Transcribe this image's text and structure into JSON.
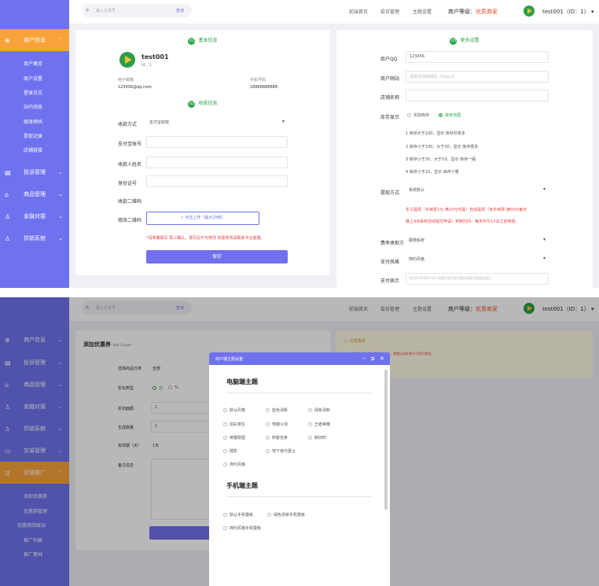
{
  "top": {
    "search_placeholder": "输入订单号",
    "search_btn": "查询",
    "nav": [
      "前端首页",
      "投诉管理",
      "主题设置"
    ],
    "level_label": "商户等级：",
    "level_value": "优质商家",
    "user": "test001（ID：1）",
    "user_caret": "▾"
  },
  "s1": {
    "sidebar": {
      "main": [
        {
          "label": "商户信息",
          "icon": "⊕"
        },
        {
          "label": "投诉管理",
          "icon": "▤"
        },
        {
          "label": "商品管理",
          "icon": "⌂"
        },
        {
          "label": "金融对接",
          "icon": "♙"
        },
        {
          "label": "供销系统",
          "icon": "♙"
        }
      ],
      "sub": [
        "商户概览",
        "商户设置",
        "登录日志",
        "站内消息",
        "修改密码",
        "提现记录",
        "店铺链接"
      ]
    },
    "basic": {
      "num": "01",
      "title": "基本信息",
      "name": "test001",
      "sub": "id：1",
      "email_label": "电子邮箱",
      "email": "123456@qq.com",
      "phone_label": "手机号码",
      "phone": "18888888888"
    },
    "receipt": {
      "num": "02",
      "title": "收款信息",
      "method_label": "收款方式",
      "method": "支付宝收款",
      "account_label": "支付宝账号",
      "name_label": "收款人姓名",
      "id_label": "身份证号",
      "qr_label": "收款二维码",
      "modify_label": "修改二维码",
      "upload": "点击上传（最大2MB）",
      "warn": "*请准确填写 再三确认，填写后不可修改 如需修改请联系平台客服。",
      "save": "保存"
    },
    "more": {
      "num": "03",
      "title": "更多设置",
      "qq_label": "商户QQ",
      "qq": "123456",
      "site_label": "商户网站",
      "site_ph": "请填写你的网站（http://）",
      "shop_label": "店铺名称",
      "stock_label": "库存显示",
      "stock_opts": [
        "实际库存",
        "库存范围"
      ],
      "stock_rules": [
        "1  库存大于100，显示 库存非常多",
        "2  库存小于100、大于30，显示 库存很多",
        "3  库存小于30、大于10，显示 库存一般",
        "4  库存小于10，显示 库存少量"
      ],
      "withdraw_label": "提现方式",
      "withdraw": "系统默认",
      "withdraw_note1": "手工提现（手续费2元 满10元可提）自动提现（免手续费 满50元每天",
      "withdraw_note2": "晚上9点系统自动提交申请）到账时间：每天中午12点之前到账。",
      "fee_label": "费率承担方",
      "fee": "跟随系统",
      "pay_label": "支付风格",
      "pay": "简约风格",
      "pay_ext_label": "支付表示",
      "pay_ext": "例如0-459597311 再遇订单出现问题前请联系客服或售后"
    }
  },
  "s2": {
    "sidebar": {
      "main": [
        {
          "label": "商户信息",
          "icon": "⊕"
        },
        {
          "label": "投诉管理",
          "icon": "▤"
        },
        {
          "label": "商品管理",
          "icon": "⌂"
        },
        {
          "label": "金融对接",
          "icon": "♙"
        },
        {
          "label": "供销系统",
          "icon": "♙"
        },
        {
          "label": "交易管理",
          "icon": "▭"
        },
        {
          "label": "营销推广",
          "icon": "⊟"
        }
      ],
      "sub": [
        "添加优惠券",
        "优惠券管理",
        "优惠券回收站",
        "推广列表",
        "推广素材"
      ]
    },
    "coupon": {
      "title": "添加优惠券",
      "title_sub": "Add Coupon",
      "cat_label": "选择商品分类",
      "cat": "全部",
      "type_label": "折扣类型",
      "type_opts": [
        "元",
        "%"
      ],
      "amount_label": "折扣面额",
      "amount": "1",
      "count_label": "生成数量",
      "count": "1",
      "days_label": "有效期（天）",
      "days": "1天",
      "note_label": "备注信息"
    },
    "tips": {
      "title": "注意事项",
      "text": "优惠券请在开始时间前生效，到期自动失效不可再次使用。"
    },
    "modal": {
      "title": "商户端主题设置",
      "pc_title": "电脑端主题",
      "pc_opts": [
        "默认风格",
        "蓝色清新",
        "绿色清新",
        "炫彩夜生",
        "穿越火线",
        "王者荣耀",
        "英雄联盟",
        "刺客信条",
        "新旧时",
        "碟影",
        "地下城与勇士",
        "简约风格"
      ],
      "mobile_title": "手机端主题",
      "mobile_opts": [
        "默认手机模板",
        "绿色清新手机模板",
        "简约风格手机模板"
      ]
    }
  }
}
